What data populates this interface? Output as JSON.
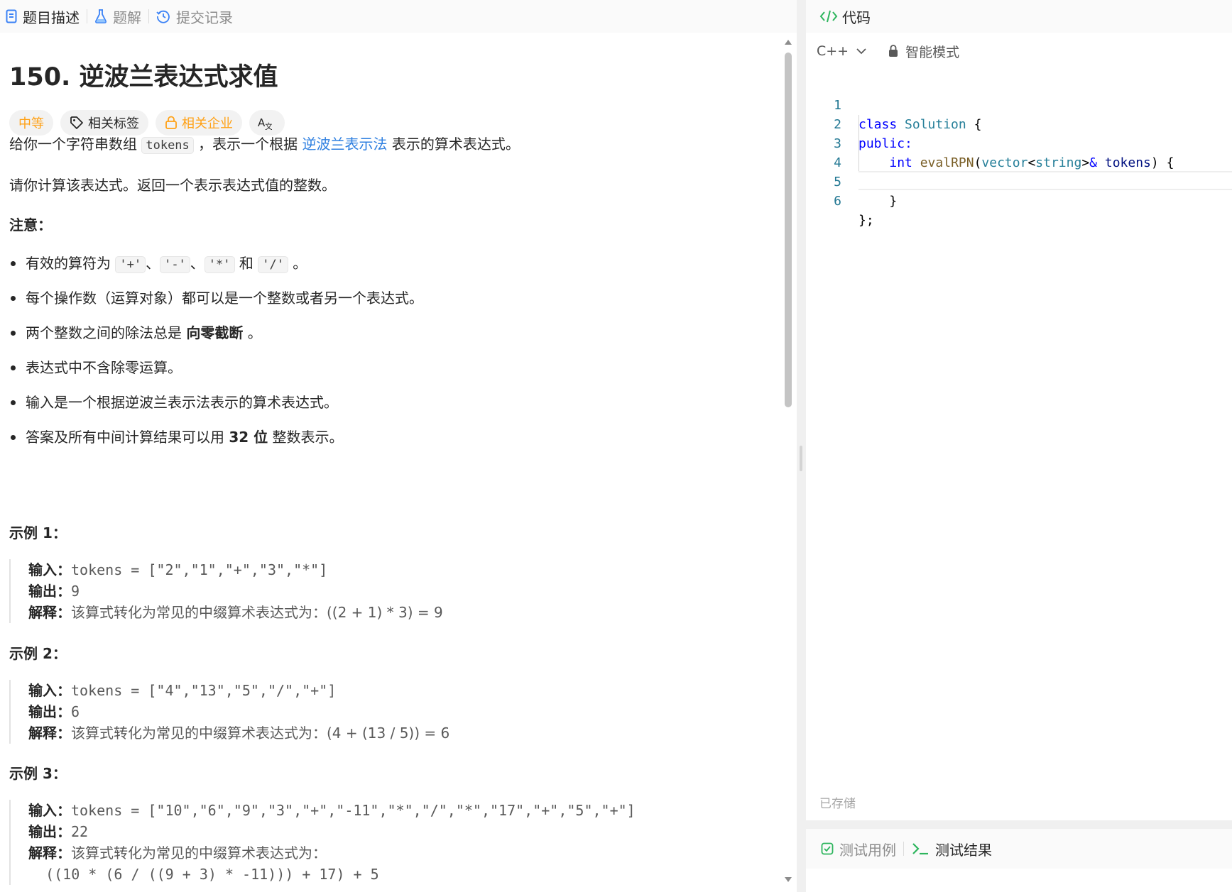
{
  "left_tabs": [
    {
      "label": "题目描述",
      "active": true
    },
    {
      "label": "题解",
      "active": false
    },
    {
      "label": "提交记录",
      "active": false
    }
  ],
  "problem": {
    "title": "150. 逆波兰表达式求值",
    "chips": {
      "difficulty": "中等",
      "tags": "相关标签",
      "companies": "相关企业"
    },
    "desc1": {
      "pre": "给你一个字符串数组 ",
      "code": "tokens",
      "mid": " ，表示一个根据 ",
      "link": "逆波兰表示法",
      "post": " 表示的算术表达式。"
    },
    "desc2": "请你计算该表达式。返回一个表示表达式值的整数。",
    "note_heading": "注意：",
    "note1": {
      "pre": "有效的算符为 ",
      "op1": "'+'",
      "sep1": "、",
      "op2": "'-'",
      "sep2": "、",
      "op3": "'*'",
      "and": " 和 ",
      "op4": "'/'",
      "post": " 。"
    },
    "note2": "每个操作数（运算对象）都可以是一个整数或者另一个表达式。",
    "note3": {
      "pre": "两个整数之间的除法总是 ",
      "bold": "向零截断",
      "post": " 。"
    },
    "note4": "表达式中不含除零运算。",
    "note5": "输入是一个根据逆波兰表示法表示的算术表达式。",
    "note6": {
      "pre": "答案及所有中间计算结果可以用 ",
      "bold": "32 位",
      "post": " 整数表示。"
    },
    "examples": [
      {
        "title": "示例 1：",
        "input_label": "输入：",
        "input": "tokens = [\"2\",\"1\",\"+\",\"3\",\"*\"]",
        "output_label": "输出：",
        "output": "9",
        "explain_label": "解释：",
        "explain": "该算式转化为常见的中缀算术表达式为：((2 + 1) * 3) = 9"
      },
      {
        "title": "示例 2：",
        "input_label": "输入：",
        "input": "tokens = [\"4\",\"13\",\"5\",\"/\",\"+\"]",
        "output_label": "输出：",
        "output": "6",
        "explain_label": "解释：",
        "explain": "该算式转化为常见的中缀算术表达式为：(4 + (13 / 5)) = 6"
      },
      {
        "title": "示例 3：",
        "input_label": "输入：",
        "input": "tokens = [\"10\",\"6\",\"9\",\"3\",\"+\",\"-11\",\"*\",\"/\",\"*\",\"17\",\"+\",\"5\",\"+\"]",
        "output_label": "输出：",
        "output": "22",
        "explain_label": "解释：",
        "explain": "该算式转化为常见的中缀算术表达式为：",
        "explain2": "  ((10 * (6 / ((9 + 3) * -11))) + 17) + 5"
      }
    ]
  },
  "editor": {
    "title": "代码",
    "language": "C++",
    "mode": "智能模式",
    "saved": "已存储",
    "line_numbers": [
      "1",
      "2",
      "3",
      "4",
      "5",
      "6"
    ],
    "code": {
      "l1_kw": "class",
      "l1_name": "Solution",
      "l1_rest": " {",
      "l2": "public:",
      "l3_indent": "    ",
      "l3_type": "int",
      "l3_fn": "evalRPN",
      "l3_p1": "(",
      "l3_vec": "vector",
      "l3_lt": "<",
      "l3_str": "string",
      "l3_gt": ">",
      "l3_amp": "&",
      "l3_param": "tokens",
      "l3_rest": ") {",
      "l5": "    }",
      "l6": "};"
    }
  },
  "result_tabs": [
    {
      "label": "测试用例"
    },
    {
      "label": "测试结果",
      "active": true
    }
  ],
  "colors": {
    "accent_orange": "#ffa116",
    "link_blue": "#2e7fe0",
    "icon_green": "#2db55d"
  }
}
